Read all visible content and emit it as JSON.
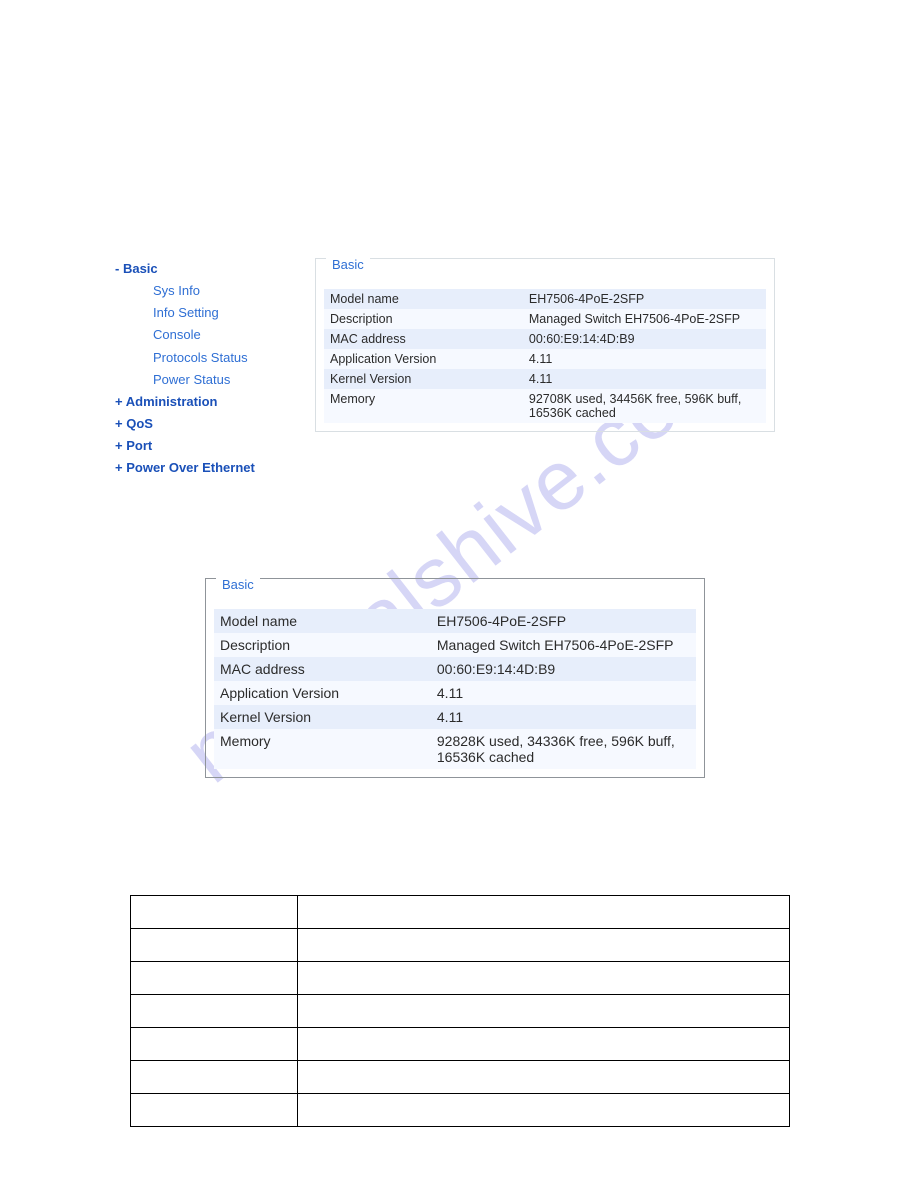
{
  "watermark": "manualshive.com",
  "nav": {
    "basic": {
      "label": "Basic",
      "kind": "top",
      "marker": "minus"
    },
    "sysinfo": {
      "label": "Sys Info",
      "kind": "sub"
    },
    "infosetting": {
      "label": "Info Setting",
      "kind": "sub"
    },
    "console": {
      "label": "Console",
      "kind": "sub"
    },
    "protocols": {
      "label": "Protocols Status",
      "kind": "sub"
    },
    "power": {
      "label": "Power Status",
      "kind": "sub"
    },
    "admin": {
      "label": "Administration",
      "kind": "top",
      "marker": "plus"
    },
    "qos": {
      "label": "QoS",
      "kind": "top",
      "marker": "plus"
    },
    "port": {
      "label": "Port",
      "kind": "top",
      "marker": "plus"
    },
    "poe": {
      "label": "Power Over Ethernet",
      "kind": "top",
      "marker": "plus"
    }
  },
  "panel1": {
    "legend": "Basic",
    "rows": {
      "model": {
        "k": "Model name",
        "v": "EH7506-4PoE-2SFP"
      },
      "desc": {
        "k": "Description",
        "v": "Managed Switch EH7506-4PoE-2SFP"
      },
      "mac": {
        "k": "MAC address",
        "v": "00:60:E9:14:4D:B9"
      },
      "appv": {
        "k": "Application Version",
        "v": "4.11"
      },
      "kernv": {
        "k": "Kernel Version",
        "v": "4.11"
      },
      "mem": {
        "k": "Memory",
        "v": "92708K used, 34456K free, 596K buff, 16536K cached"
      }
    }
  },
  "panel2": {
    "legend": "Basic",
    "rows": {
      "model": {
        "k": "Model name",
        "v": "EH7506-4PoE-2SFP"
      },
      "desc": {
        "k": "Description",
        "v": "Managed Switch EH7506-4PoE-2SFP"
      },
      "mac": {
        "k": "MAC address",
        "v": "00:60:E9:14:4D:B9"
      },
      "appv": {
        "k": "Application Version",
        "v": "4.11"
      },
      "kernv": {
        "k": "Kernel Version",
        "v": "4.11"
      },
      "mem": {
        "k": "Memory",
        "v": "92828K used, 34336K free, 596K buff, 16536K cached"
      }
    }
  },
  "descTable": {
    "header": {
      "label": "",
      "desc": ""
    },
    "rows": {
      "r1": {
        "l": "",
        "d": ""
      },
      "r2": {
        "l": "",
        "d": ""
      },
      "r3": {
        "l": "",
        "d": ""
      },
      "r4": {
        "l": "",
        "d": ""
      },
      "r5": {
        "l": "",
        "d": ""
      },
      "r6": {
        "l": "",
        "d": ""
      }
    }
  }
}
